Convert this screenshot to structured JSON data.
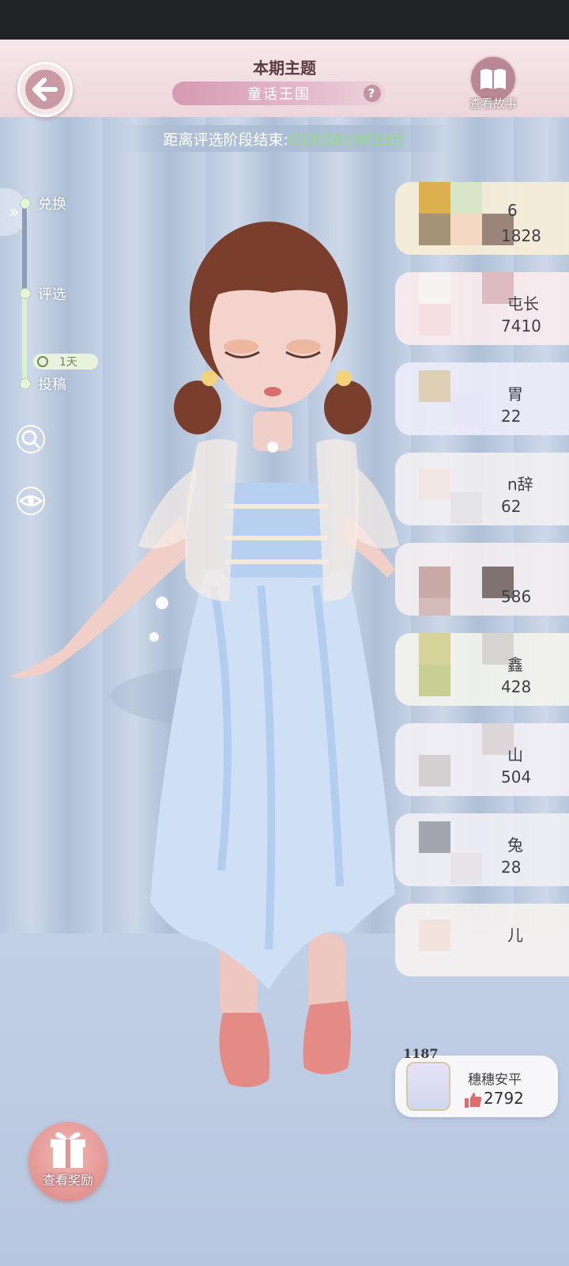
{
  "header": {
    "theme_title": "本期主题",
    "theme_name": "童话王国",
    "help_symbol": "?",
    "story_label": "查看故事"
  },
  "countdown": {
    "prefix": "距离评选阶段结束:",
    "time": "03天08小时33分"
  },
  "stages": {
    "items": [
      {
        "label": "兑换"
      },
      {
        "label": "评选"
      },
      {
        "label": "投稿"
      }
    ],
    "badge": "1天"
  },
  "tools": {
    "search_icon": "search-icon",
    "eye_icon": "eye-icon"
  },
  "ranking": [
    {
      "name": "6",
      "score": "1828"
    },
    {
      "name": "屯长",
      "score": "7410"
    },
    {
      "name": "胃",
      "score": "22"
    },
    {
      "name": "n辞",
      "score": "62"
    },
    {
      "name": "",
      "score": "586"
    },
    {
      "name": "鑫",
      "score": "428"
    },
    {
      "name": "山",
      "score": "504"
    },
    {
      "name": "兔",
      "score": "28"
    },
    {
      "name": "儿",
      "score": ""
    }
  ],
  "my_entry": {
    "rank": "1187",
    "name": "穗穗安平",
    "likes": "2792"
  },
  "reward_button": {
    "label": "查看奖励"
  },
  "colors": {
    "accent_pink": "#d69ab1",
    "countdown_green": "#8de07c",
    "like_red": "#e06b6b"
  }
}
